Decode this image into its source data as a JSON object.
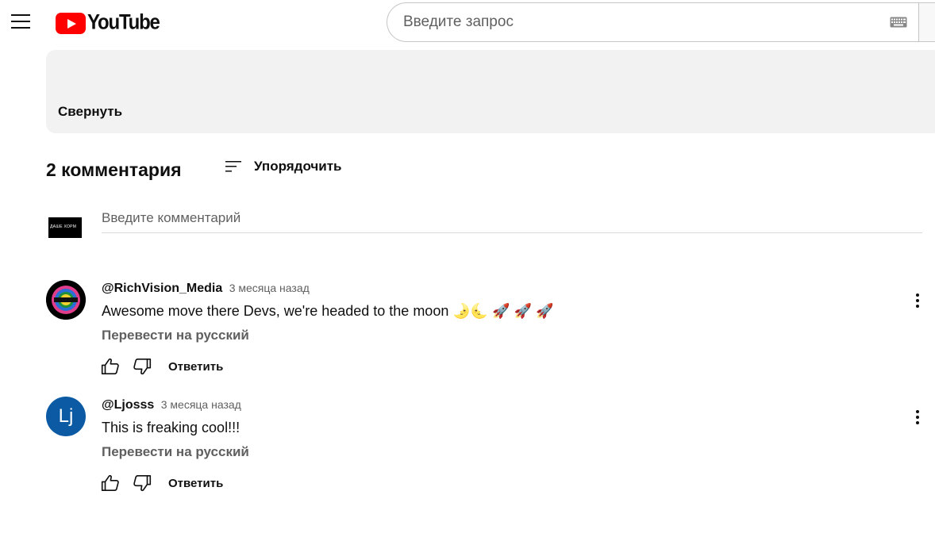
{
  "header": {
    "logo_text": "YouTube",
    "search_placeholder": "Введите запрос"
  },
  "description": {
    "collapse_label": "Свернуть"
  },
  "comments_section": {
    "count_label": "2 комментария",
    "sort_label": "Упорядочить",
    "add_comment_placeholder": "Введите комментарий",
    "my_avatar_text": "ДАШЕ ХОРМ"
  },
  "comments": [
    {
      "author": "@RichVision_Media",
      "time": "3 месяца назад",
      "text": "Awesome move there Devs, we're headed to the moon 🌛🌜 🚀 🚀 🚀",
      "translate_label": "Перевести на русский",
      "reply_label": "Ответить",
      "avatar_initials": ""
    },
    {
      "author": "@Ljosss",
      "time": "3 месяца назад",
      "text": "This is freaking cool!!!",
      "translate_label": "Перевести на русский",
      "reply_label": "Ответить",
      "avatar_initials": "Lj"
    }
  ],
  "colors": {
    "brand_red": "#ff0000",
    "avatar_blue": "#0b5aa3",
    "secondary_text": "#606060",
    "panel_bg": "#f2f2f2"
  },
  "icons": [
    "menu-icon",
    "youtube-logo-icon",
    "keyboard-icon",
    "sort-icon",
    "like-icon",
    "dislike-icon",
    "more-vert-icon"
  ]
}
